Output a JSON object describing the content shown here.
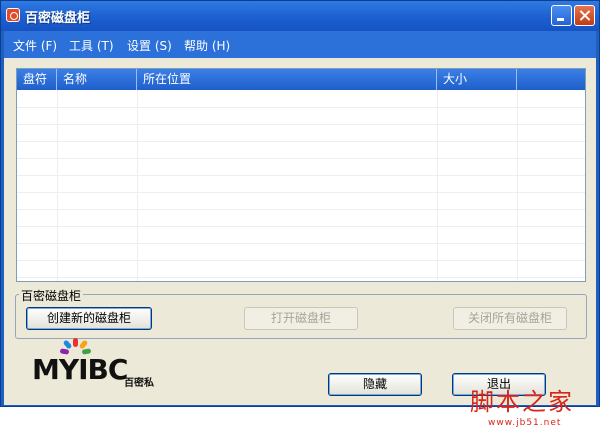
{
  "window": {
    "title": "百密磁盘柜"
  },
  "icons": {
    "app": "cabinet-app-icon",
    "minimize": "minimize-icon",
    "close": "close-icon"
  },
  "menu": [
    {
      "label": "文件 (F)"
    },
    {
      "label": "工具 (T)"
    },
    {
      "label": "设置 (S)"
    },
    {
      "label": "帮助 (H)"
    }
  ],
  "list": {
    "columns": [
      "盘符",
      "名称",
      "所在位置",
      "大小"
    ],
    "rows": []
  },
  "group": {
    "title": "百密磁盘柜",
    "buttons": {
      "create": "创建新的磁盘柜",
      "open": "打开磁盘柜",
      "close_all": "关闭所有磁盘柜"
    }
  },
  "logo": {
    "text": "MYIBC",
    "subtitle": "百密私"
  },
  "footer": {
    "hide": "隐藏",
    "exit": "退出"
  },
  "watermark": {
    "text": "脚本之家",
    "url": "www.jb51.net"
  },
  "colors": {
    "titlebar": "#1c5fd0",
    "face": "#ece9d8",
    "list_header": "#2a6fd9",
    "watermark": "#d8241a"
  }
}
